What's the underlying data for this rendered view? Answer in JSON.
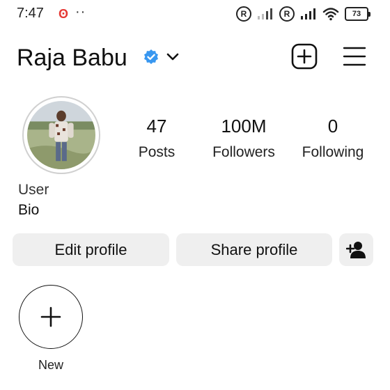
{
  "status_bar": {
    "time": "7:47",
    "notification_icon": "vodafone-icon",
    "dots": "··",
    "battery_level": "73"
  },
  "profile": {
    "username": "Raja Babu",
    "verified": true,
    "stats": {
      "posts": {
        "value": "47",
        "label": "Posts"
      },
      "followers": {
        "value": "100M",
        "label": "Followers"
      },
      "following": {
        "value": "0",
        "label": "Following"
      }
    },
    "bio": {
      "line1": "User",
      "line2": "Bio"
    }
  },
  "actions": {
    "edit_profile": "Edit profile",
    "share_profile": "Share profile"
  },
  "highlights": {
    "new_label": "New"
  },
  "colors": {
    "verified_blue": "#3897f0",
    "button_bg": "#efefef",
    "notification_red": "#e53935"
  }
}
